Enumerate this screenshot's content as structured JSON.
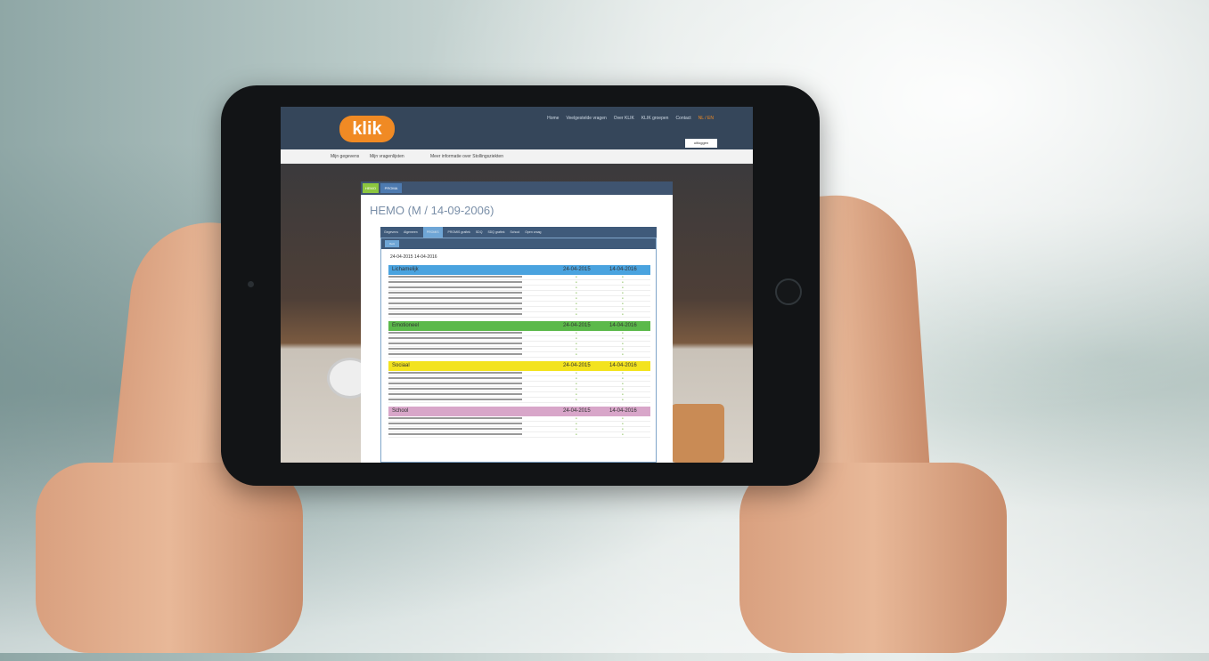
{
  "nav": {
    "links": [
      "Home",
      "Veelgestelde vragen",
      "Over KLIK",
      "KLIK groepen",
      "Contact"
    ],
    "lang": "NL / EN",
    "logout": "uitloggen",
    "logo": "klik"
  },
  "subnav": [
    "Mijn gegevens",
    "Mijn vragenlijsten",
    "Meer informatie over Stollingsziekten"
  ],
  "panel": {
    "tabs": [
      "HEMO",
      "PROMA"
    ],
    "title": "HEMO (M / 14-09-2006)",
    "subtabs": [
      "Gegevens",
      "Algemeen",
      "PROMIS",
      "PROMIS grafiek",
      "SDQ",
      "SDQ grafiek",
      "School",
      "Open vraag"
    ],
    "inner_button": "Kort",
    "dates": "24-04-2015   14-04-2016"
  },
  "sections": [
    {
      "title": "Lichamelijk",
      "date1": "24-04-2015",
      "date2": "14-04-2016",
      "color": "#4aa3df",
      "rows": 8
    },
    {
      "title": "Emotioneel",
      "date1": "24-04-2015",
      "date2": "14-04-2016",
      "color": "#5bb94a",
      "rows": 5
    },
    {
      "title": "Sociaal",
      "date1": "24-04-2015",
      "date2": "14-04-2016",
      "color": "#f3e31e",
      "rows": 6
    },
    {
      "title": "School",
      "date1": "24-04-2015",
      "date2": "14-04-2016",
      "color": "#d8a6c9",
      "rows": 4
    }
  ]
}
